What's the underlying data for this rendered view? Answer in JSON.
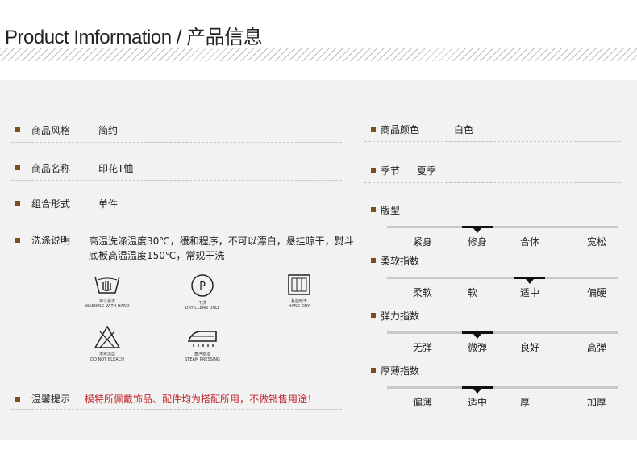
{
  "header": {
    "title": "Product Imformation / 产品信息"
  },
  "left": {
    "rows": [
      {
        "label": "商品风格",
        "value": "简约"
      },
      {
        "label": "商品名称",
        "value": "印花T恤"
      },
      {
        "label": "组合形式",
        "value": "单件"
      }
    ],
    "care": {
      "label": "洗涤说明",
      "text": "高温洗涤温度30℃，缓和程序，不可以漂白，悬挂晾干，熨斗底板高温温度150℃，常规干洗",
      "icons": [
        {
          "icon": "hand-wash-icon",
          "cn": "可以手洗",
          "en": "WASHING WITH HAND"
        },
        {
          "icon": "dry-clean-icon",
          "cn": "干洗",
          "en": "DRY CLEAN ONLY"
        },
        {
          "icon": "hang-dry-icon",
          "cn": "悬挂晾干",
          "en": "HANG DRY"
        },
        {
          "icon": "no-bleach-icon",
          "cn": "不可漂白",
          "en": "DO NOT BLEACH"
        },
        {
          "icon": "steam-iron-icon",
          "cn": "蒸汽熨烫",
          "en": "STEAM PRESSING"
        }
      ]
    },
    "tip": {
      "label": "温馨提示",
      "text": "模特所佩戴饰品、配件均为搭配所用，不做销售用途！"
    }
  },
  "right": {
    "rows": [
      {
        "label": "商品颜色",
        "value": "白色"
      },
      {
        "label": "季节",
        "value": "夏季"
      }
    ],
    "scales": [
      {
        "label": "版型",
        "options": [
          "紧身",
          "修身",
          "合体",
          "宽松"
        ],
        "selected": 1
      },
      {
        "label": "柔软指数",
        "options": [
          "柔软",
          "软",
          "适中",
          "偏硬"
        ],
        "selected": 2
      },
      {
        "label": "弹力指数",
        "options": [
          "无弹",
          "微弹",
          "良好",
          "高弹"
        ],
        "selected": 1
      },
      {
        "label": "厚薄指数",
        "options": [
          "偏薄",
          "适中",
          "厚",
          "加厚"
        ],
        "selected": 1
      }
    ]
  },
  "colors": {
    "bullet": "#7a4f1e",
    "panel": "#f2f2f2",
    "note": "#c1272d"
  }
}
